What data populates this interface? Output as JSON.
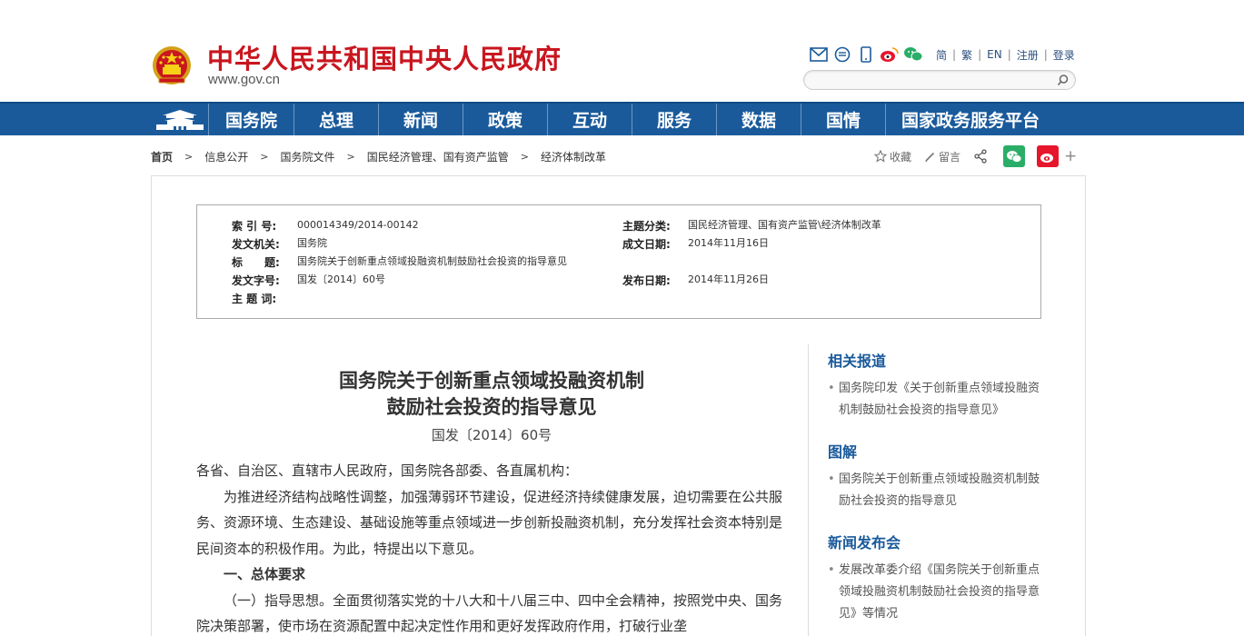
{
  "header": {
    "title": "中华人民共和国中央人民政府",
    "url": "www.gov.cn",
    "links": [
      "简",
      "繁",
      "EN",
      "注册",
      "登录"
    ],
    "search_placeholder": ""
  },
  "nav": {
    "items": [
      "国务院",
      "总理",
      "新闻",
      "政策",
      "互动",
      "服务",
      "数据",
      "国情",
      "国家政务服务平台"
    ]
  },
  "breadcrumb": [
    "首页",
    "信息公开",
    "国务院文件",
    "国民经济管理、国有资产监管",
    "经济体制改革"
  ],
  "share": {
    "favorite": "收藏",
    "comment": "留言",
    "more": "+"
  },
  "meta": {
    "index_label": "索 引 号:",
    "index_value": "000014349/2014-00142",
    "topic_label": "主题分类:",
    "topic_value": "国民经济管理、国有资产监管\\经济体制改革",
    "issuer_label": "发文机关:",
    "issuer_value": "国务院",
    "created_label": "成文日期:",
    "created_value": "2014年11月16日",
    "title_label": "标　　题:",
    "title_value": "国务院关于创新重点领域投融资机制鼓励社会投资的指导意见",
    "docno_label": "发文字号:",
    "docno_value": "国发〔2014〕60号",
    "published_label": "发布日期:",
    "published_value": "2014年11月26日",
    "keywords_label": "主 题 词:",
    "keywords_value": ""
  },
  "article": {
    "title_line1": "国务院关于创新重点领域投融资机制",
    "title_line2": "鼓励社会投资的指导意见",
    "docno": "国发〔2014〕60号",
    "salutation": "各省、自治区、直辖市人民政府，国务院各部委、各直属机构：",
    "para1": "为推进经济结构战略性调整，加强薄弱环节建设，促进经济持续健康发展，迫切需要在公共服务、资源环境、生态建设、基础设施等重点领域进一步创新投融资机制，充分发挥社会资本特别是民间资本的积极作用。为此，特提出以下意见。",
    "section1": "一、总体要求",
    "para2": "（一）指导思想。全面贯彻落实党的十八大和十八届三中、四中全会精神，按照党中央、国务院决策部署，使市场在资源配置中起决定性作用和更好发挥政府作用，打破行业垄"
  },
  "sidebar": {
    "related_head": "相关报道",
    "related_items": [
      "国务院印发《关于创新重点领域投融资机制鼓励社会投资的指导意见》"
    ],
    "graphic_head": "图解",
    "graphic_items": [
      "国务院关于创新重点领域投融资机制鼓励社会投资的指导意见"
    ],
    "press_head": "新闻发布会",
    "press_items": [
      "发展改革委介绍《国务院关于创新重点领域投融资机制鼓励社会投资的指导意见》等情况"
    ]
  },
  "colors": {
    "brand_red": "#c9161f",
    "nav_blue": "#1a5a9b",
    "wechat_green": "#2aae67",
    "weibo_red": "#e6162d"
  }
}
